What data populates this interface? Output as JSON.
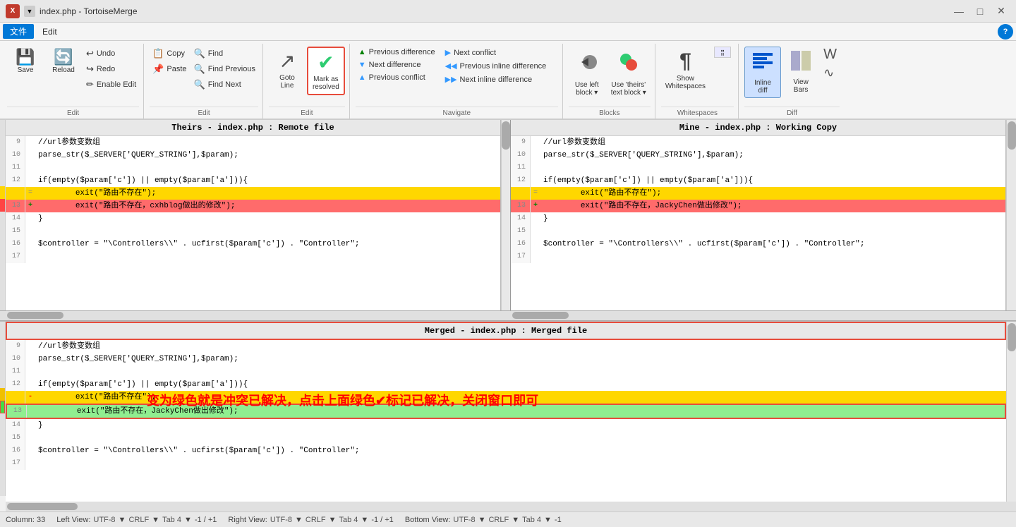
{
  "titleBar": {
    "icon": "X",
    "title": "index.php - TortoiseMerge",
    "minBtn": "—",
    "maxBtn": "□",
    "closeBtn": "✕"
  },
  "menuBar": {
    "items": [
      "文件",
      "Edit"
    ],
    "helpBtn": "?"
  },
  "ribbon": {
    "groups": [
      {
        "label": "Edit",
        "buttons": [
          {
            "id": "save",
            "icon": "💾",
            "label": "Save",
            "large": true
          },
          {
            "id": "reload",
            "icon": "🔄",
            "label": "Reload",
            "large": true
          }
        ],
        "subButtons": [
          {
            "id": "undo",
            "icon": "↩",
            "label": "Undo"
          },
          {
            "id": "redo",
            "icon": "↪",
            "label": "Redo"
          },
          {
            "id": "enable-edit",
            "icon": "✏",
            "label": "Enable Edit"
          }
        ]
      },
      {
        "label": "Edit",
        "buttons": [],
        "subButtons": [
          {
            "id": "copy",
            "icon": "📋",
            "label": "Copy"
          },
          {
            "id": "paste",
            "icon": "📌",
            "label": "Paste"
          }
        ],
        "subButtons2": [
          {
            "id": "find",
            "icon": "🔍",
            "label": "Find"
          },
          {
            "id": "find-previous",
            "icon": "🔍",
            "label": "Find Previous"
          },
          {
            "id": "find-next",
            "icon": "🔍",
            "label": "Find Next"
          }
        ]
      },
      {
        "label": "Edit",
        "buttons": [
          {
            "id": "goto-line",
            "icon": "↗",
            "label": "Goto\nLine",
            "large": true
          },
          {
            "id": "mark-resolved",
            "icon": "✔",
            "label": "Mark as\nresolved",
            "large": true,
            "highlighted": true
          }
        ]
      },
      {
        "label": "Navigate",
        "navCols": [
          [
            {
              "id": "prev-diff",
              "icon": "▲",
              "label": "Previous difference",
              "color": "green"
            },
            {
              "id": "next-diff",
              "icon": "▼",
              "label": "Next difference",
              "color": "blue"
            },
            {
              "id": "prev-conflict",
              "icon": "▲",
              "label": "Previous conflict",
              "color": "blue"
            }
          ],
          [
            {
              "id": "next-conflict",
              "icon": "▶",
              "label": "Next conflict",
              "color": "blue"
            },
            {
              "id": "prev-inline-diff",
              "icon": "◀◀",
              "label": "Previous inline difference",
              "color": "blue"
            },
            {
              "id": "next-inline-diff",
              "icon": "▶▶",
              "label": "Next inline difference",
              "color": "blue"
            }
          ]
        ]
      },
      {
        "label": "Blocks",
        "buttons": [
          {
            "id": "use-left-block",
            "icon": "⬅",
            "label": "Use left\nblock ▾",
            "large": true
          },
          {
            "id": "use-theirs-block",
            "icon": "👥",
            "label": "Use 'theirs'\ntext block ▾",
            "large": true
          }
        ]
      },
      {
        "label": "Whitespaces",
        "buttons": [
          {
            "id": "show-whitespaces",
            "icon": "¶",
            "label": "Show\nWhitespaces",
            "large": true
          }
        ]
      },
      {
        "label": "Diff",
        "buttons": [
          {
            "id": "inline-diff",
            "icon": "≡",
            "label": "Inline\ndiff",
            "large": true
          },
          {
            "id": "view-bars",
            "icon": "▦",
            "label": "View\nBars",
            "large": true
          }
        ]
      }
    ]
  },
  "theirs": {
    "header": "Theirs - index.php : Remote file",
    "lines": [
      {
        "num": 9,
        "content": "//url参数变数组",
        "type": "normal"
      },
      {
        "num": 10,
        "content": "parse_str($_SERVER['QUERY_STRING'],$param);",
        "type": "normal"
      },
      {
        "num": 11,
        "content": "",
        "type": "normal"
      },
      {
        "num": 12,
        "content": "if(empty($param['c']) || empty($param['a'])){",
        "type": "normal"
      },
      {
        "num": "",
        "content": "\texit(\"路由不存在\");",
        "type": "yellow",
        "marker": "="
      },
      {
        "num": 13,
        "content": "\texit(\"路由不存在，cxhblog做出的修改\");",
        "type": "red",
        "marker": "+"
      },
      {
        "num": 14,
        "content": "}",
        "type": "normal"
      },
      {
        "num": 15,
        "content": "",
        "type": "normal"
      },
      {
        "num": 16,
        "content": "$controller = \"\\Controllers\\\\\" . ucfirst($param['c']) . \"Controller\";",
        "type": "normal"
      },
      {
        "num": 17,
        "content": "",
        "type": "normal"
      }
    ]
  },
  "mine": {
    "header": "Mine - index.php : Working Copy",
    "lines": [
      {
        "num": 9,
        "content": "//url参数变数组",
        "type": "normal"
      },
      {
        "num": 10,
        "content": "parse_str($_SERVER['QUERY_STRING'],$param);",
        "type": "normal"
      },
      {
        "num": 11,
        "content": "",
        "type": "normal"
      },
      {
        "num": 12,
        "content": "if(empty($param['c']) || empty($param['a'])){",
        "type": "normal"
      },
      {
        "num": "",
        "content": "\texit(\"路由不存在\");",
        "type": "yellow",
        "marker": "="
      },
      {
        "num": 13,
        "content": "\texit(\"路由不存在，JackyChen做出修改\");",
        "type": "red",
        "marker": "+"
      },
      {
        "num": 14,
        "content": "}",
        "type": "normal"
      },
      {
        "num": 15,
        "content": "",
        "type": "normal"
      },
      {
        "num": 16,
        "content": "$controller = \"\\Controllers\\\\\" . ucfirst($param['c']) . \"Controller\";",
        "type": "normal"
      },
      {
        "num": 17,
        "content": "",
        "type": "normal"
      }
    ]
  },
  "merged": {
    "header": "Merged - index.php : Merged file",
    "lines": [
      {
        "num": 9,
        "content": "//url参数变数组",
        "type": "normal"
      },
      {
        "num": 10,
        "content": "parse_str($_SERVER['QUERY_STRING'],$param);",
        "type": "normal"
      },
      {
        "num": 11,
        "content": "",
        "type": "normal"
      },
      {
        "num": 12,
        "content": "if(empty($param['c']) || empty($param['a'])){",
        "type": "normal"
      },
      {
        "num": "",
        "content": "\texit(\"路由不存在\");",
        "type": "yellow",
        "marker": "-"
      },
      {
        "num": 13,
        "content": "\texit(\"路由不存在，JackyChen做出修改\");",
        "type": "green-highlight",
        "marker": ""
      },
      {
        "num": 14,
        "content": "}",
        "type": "normal"
      },
      {
        "num": 15,
        "content": "",
        "type": "normal"
      },
      {
        "num": 16,
        "content": "$controller = \"\\Controllers\\\\\" . ucfirst($param['c']) . \"Controller\";",
        "type": "normal"
      },
      {
        "num": 17,
        "content": "",
        "type": "normal"
      }
    ]
  },
  "annotation": "变为绿色就是冲突已解决，点击上面绿色✔标记已解决，关闭窗口即可",
  "statusBar": {
    "column": "Column: 33",
    "leftView": "Left View:",
    "leftEncoding": "UTF-8",
    "leftLineEnding": "CRLF",
    "leftTab": "Tab 4",
    "leftPos": "-1 / +1",
    "rightView": "Right View:",
    "rightEncoding": "UTF-8",
    "rightLineEnding": "CRLF",
    "rightTab": "Tab 4",
    "rightPos": "-1 / +1",
    "bottomView": "Bottom View:",
    "bottomEncoding": "UTF-8",
    "bottomLineEnding": "CRLF",
    "bottomTab": "Tab 4",
    "bottomPos": "-1"
  }
}
